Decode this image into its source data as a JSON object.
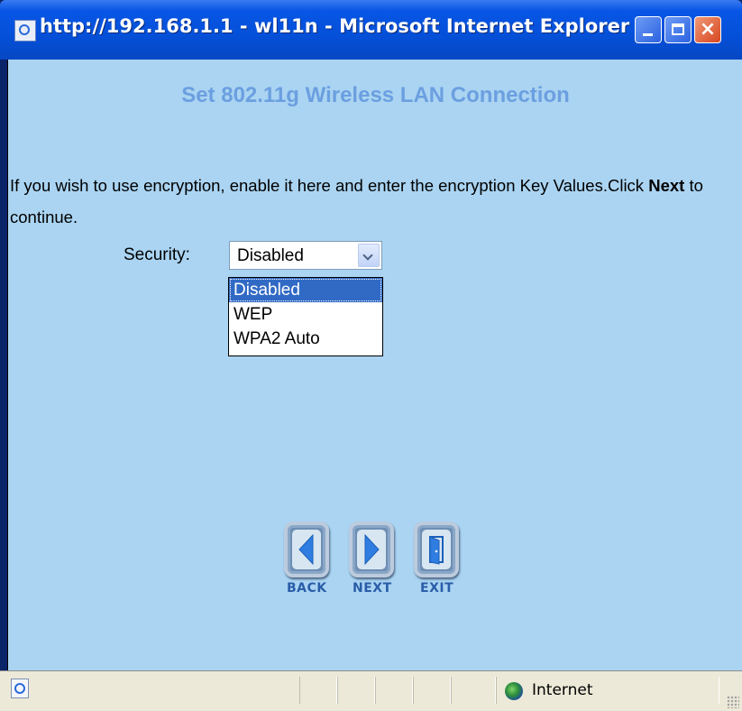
{
  "window": {
    "title": "http://192.168.1.1 - wl11n - Microsoft Internet Explorer",
    "title_icon": "ie-page-icon",
    "controls": {
      "minimize": "minimize-icon",
      "maximize": "maximize-icon",
      "close": "×"
    }
  },
  "page": {
    "title": "Set 802.11g Wireless LAN Connection",
    "instruction_pre": "If you wish to use encryption, enable it here and enter the encryption Key Values.Click ",
    "instruction_bold": "Next",
    "instruction_post": " to continue.",
    "security_label": "Security:",
    "security_value": "Disabled",
    "security_options": [
      "Disabled",
      "WEP",
      "WPA2 Auto"
    ],
    "selected_option_index": 0
  },
  "nav": {
    "back_label": "BACK",
    "next_label": "NEXT",
    "exit_label": "EXIT"
  },
  "statusbar": {
    "zone": "Internet"
  },
  "colors": {
    "content_bg": "#aad4f2",
    "title_color": "#6b9fe0",
    "selection": "#316ac5",
    "nav_label": "#2a5da8"
  }
}
